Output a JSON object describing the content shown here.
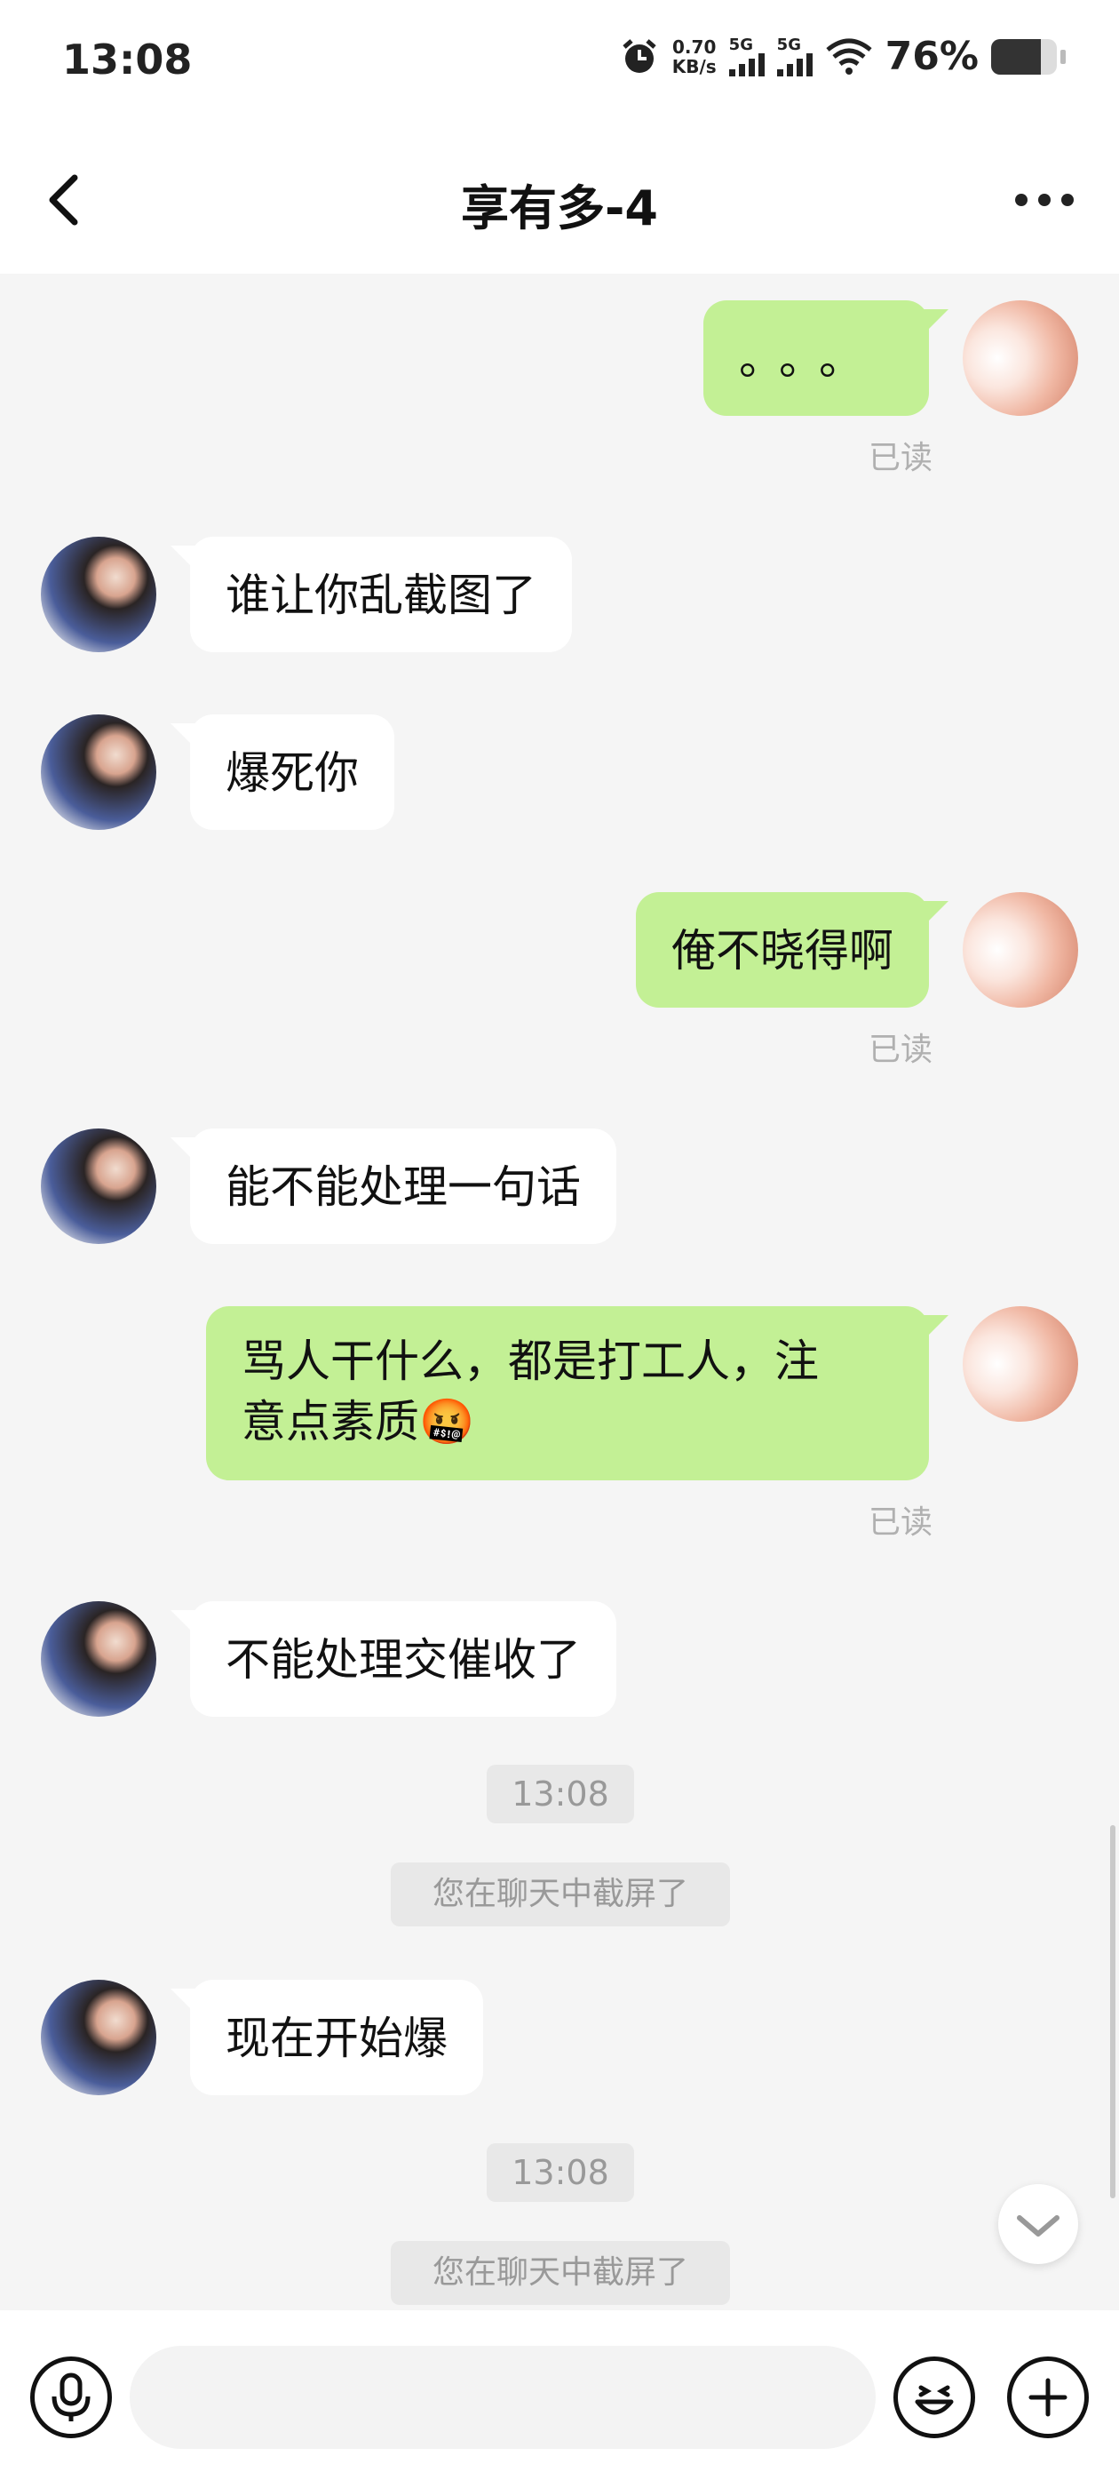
{
  "status": {
    "time": "13:08",
    "net_speed_value": "0.70",
    "net_speed_unit": "KB/s",
    "sig1": "5G",
    "sig2": "5G",
    "battery": "76%",
    "battery_level_pct": 76
  },
  "header": {
    "title": "享有多-4",
    "back_icon": "chevron-left-icon",
    "more_icon": "more-dots-icon"
  },
  "messages": [
    {
      "from": "me",
      "text": "。。。",
      "read": "已读"
    },
    {
      "from": "them",
      "text": "谁让你乱截图了"
    },
    {
      "from": "them",
      "text": "爆死你"
    },
    {
      "from": "me",
      "text": "俺不晓得啊",
      "read": "已读"
    },
    {
      "from": "them",
      "text": "能不能处理一句话"
    },
    {
      "from": "me",
      "text_line1": "骂人干什么，都是打工人，注",
      "text_line2": "意点素质",
      "emoji": "🤬",
      "read": "已读"
    },
    {
      "from": "them",
      "text": "不能处理交催收了"
    },
    {
      "from": "them",
      "text": "现在开始爆"
    }
  ],
  "system": {
    "time1": "13:08",
    "notice1": "您在聊天中截屏了",
    "time2": "13:08",
    "notice2": "您在聊天中截屏了"
  },
  "input": {
    "placeholder": "",
    "voice_icon": "microphone-icon",
    "emoji_icon": "smiley-icon",
    "plus_icon": "plus-icon"
  },
  "colors": {
    "my_bubble": "#c3f095",
    "their_bubble": "#ffffff",
    "background": "#f5f5f5"
  }
}
